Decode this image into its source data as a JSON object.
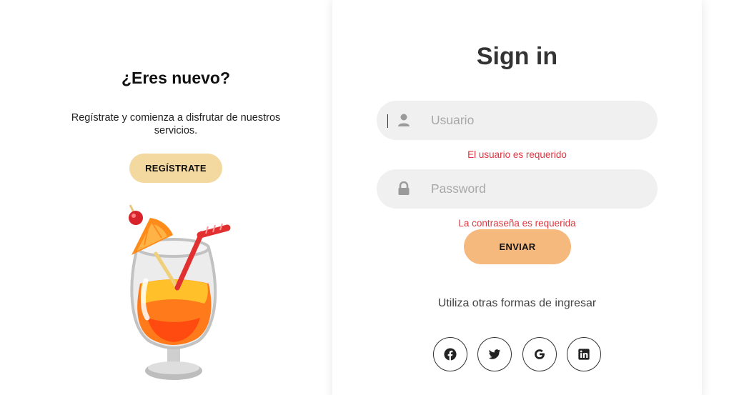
{
  "signup": {
    "title": "¿Eres nuevo?",
    "description": "Regístrate y comienza a disfrutar de nuestros servicios.",
    "button_label": "REGÍSTRATE"
  },
  "signin": {
    "title": "Sign in",
    "username": {
      "placeholder": "Usuario",
      "value": "",
      "error": "El usuario es requerido"
    },
    "password": {
      "placeholder": "Password",
      "value": "",
      "error": "La contraseña es requerida"
    },
    "submit_label": "ENVIAR",
    "alt_text": "Utiliza otras formas de ingresar",
    "social": [
      {
        "name": "facebook",
        "icon": "facebook-icon"
      },
      {
        "name": "twitter",
        "icon": "twitter-icon"
      },
      {
        "name": "google",
        "icon": "google-icon"
      },
      {
        "name": "linkedin",
        "icon": "linkedin-icon"
      }
    ]
  },
  "colors": {
    "signup_button": "#f3d9a0",
    "submit_button": "#f5b97e",
    "error_text": "#e0353f",
    "input_background": "#f0f0f0"
  }
}
